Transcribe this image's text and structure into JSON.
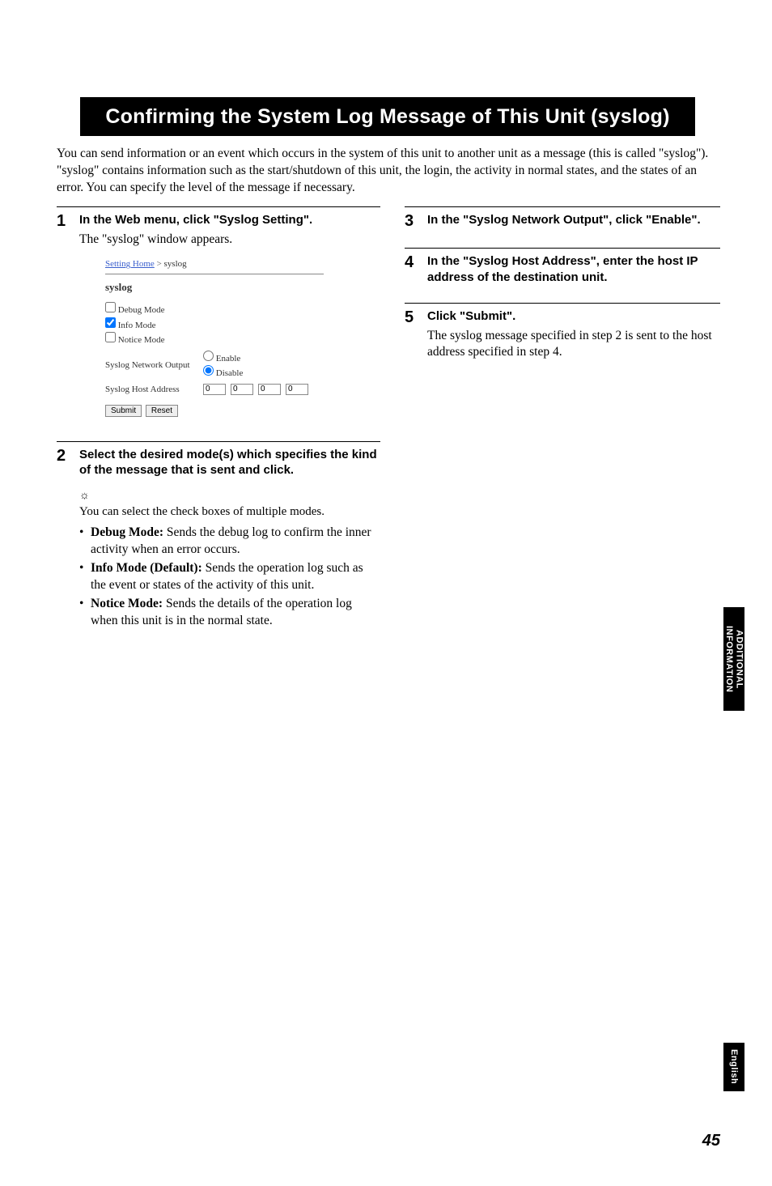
{
  "title": "Confirming the System Log Message of This Unit (syslog)",
  "intro": "You can send information or an event which occurs in the system of this unit to another unit as a message (this is called \"syslog\"). \"syslog\" contains information such as the start/shutdown of this unit, the login, the activity in normal states, and the states of an error. You can specify the level of the message if necessary.",
  "steps": {
    "s1": {
      "num": "1",
      "title": "In the Web menu, click \"Syslog Setting\".",
      "desc": "The \"syslog\" window appears."
    },
    "s2": {
      "num": "2",
      "title": "Select the desired mode(s) which specifies the kind of the message that is sent and click."
    },
    "s3": {
      "num": "3",
      "title": "In the \"Syslog Network Output\", click \"Enable\"."
    },
    "s4": {
      "num": "4",
      "title": "In the \"Syslog Host Address\", enter the host IP address of the destination unit."
    },
    "s5": {
      "num": "5",
      "title": "Click \"Submit\".",
      "desc": "The syslog message specified in step 2 is sent to the host address specified in step 4."
    }
  },
  "tip": {
    "icon": "☼",
    "text": "You can select the check boxes of multiple modes."
  },
  "bullets": {
    "b1_strong": "Debug Mode:",
    "b1_rest": " Sends the debug log to confirm the inner activity when an error occurs.",
    "b2_strong": "Info Mode (Default):",
    "b2_rest": " Sends the operation log such as the event or states of the activity of this unit.",
    "b3_strong": "Notice Mode:",
    "b3_rest": " Sends the details of the operation log when this unit is in the normal state."
  },
  "screenshot": {
    "crumb1": "Setting Home",
    "crumb_sep": " > ",
    "crumb2": "syslog",
    "heading": "syslog",
    "cb1": "Debug Mode",
    "cb2": "Info Mode",
    "cb3": "Notice Mode",
    "row_out": "Syslog Network Output",
    "r_enable": "Enable",
    "r_disable": "Disable",
    "row_addr": "Syslog Host Address",
    "addr_val": "0",
    "btn_submit": "Submit",
    "btn_reset": "Reset"
  },
  "sidetab": "ADDITIONAL INFORMATION",
  "sidetab_lang": "English",
  "page_number": "45"
}
